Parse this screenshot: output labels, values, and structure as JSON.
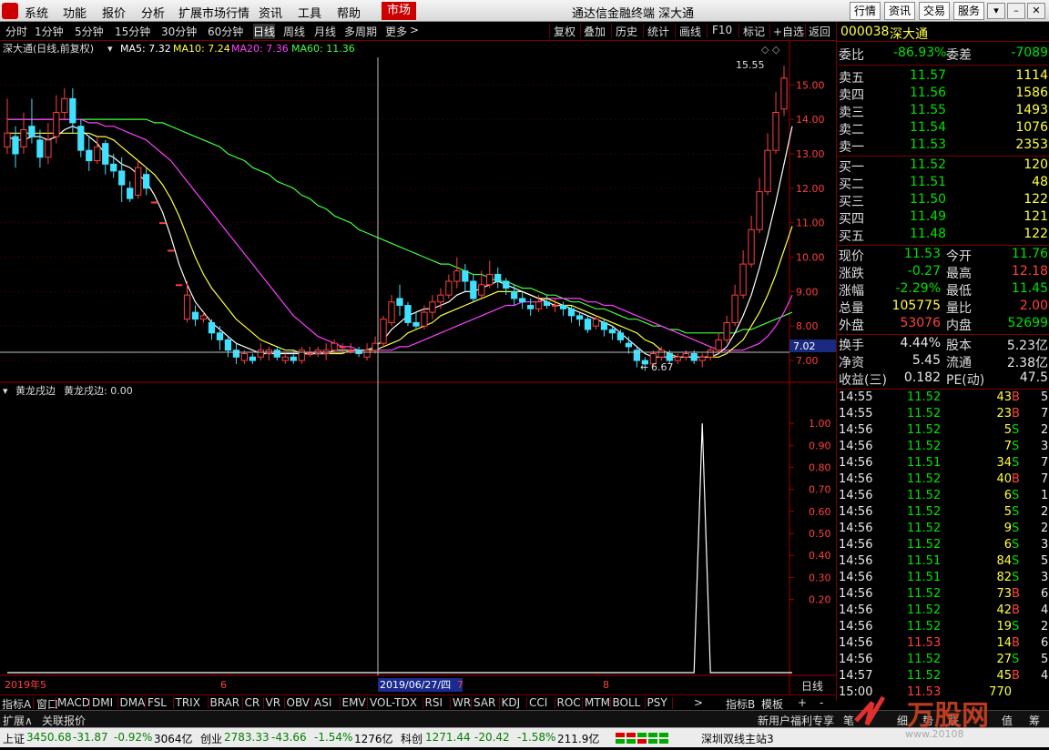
{
  "menu": {
    "items": [
      "系统",
      "功能",
      "报价",
      "分析",
      "扩展市场行情",
      "资讯",
      "工具",
      "帮助"
    ],
    "active": "市场",
    "title": "通达信金融终端 深大通",
    "right_buttons": [
      "行情",
      "资讯",
      "交易",
      "服务"
    ]
  },
  "toolbar": {
    "periods": [
      "分时",
      "1分钟",
      "5分钟",
      "15分钟",
      "30分钟",
      "60分钟",
      "日线",
      "周线",
      "月线",
      "多周期",
      "更多"
    ],
    "active_period": "日线",
    "actions": [
      "复权",
      "叠加",
      "历史",
      "统计",
      "画线",
      "F10",
      "标记",
      "+自选",
      "返回"
    ]
  },
  "chart": {
    "header": "深大通(日线,前复权)",
    "ma_labels": [
      {
        "text": "MA5: 7.32",
        "color": "#ffffff"
      },
      {
        "text": "MA10: 7.24",
        "color": "#ffff40"
      },
      {
        "text": "MA20: 7.36",
        "color": "#ff40ff"
      },
      {
        "text": "MA60: 11.36",
        "color": "#40ff40"
      }
    ],
    "price_axis": [
      "15.00",
      "14.00",
      "13.00",
      "12.00",
      "11.00",
      "10.00",
      "9.00",
      "8.00",
      "7.00"
    ],
    "current_price_tag": "7.02",
    "high_marker": "15.55",
    "low_marker": "6.67",
    "indicator_title": "黄龙戌边",
    "indicator_value": "黄龙戌边: 0.00",
    "indicator_axis": [
      "1.00",
      "0.90",
      "0.80",
      "0.70",
      "0.60",
      "0.50",
      "0.40",
      "0.30",
      "0.20"
    ],
    "date_labels": [
      "2019年5",
      "6",
      "2019/06/27/四",
      "7",
      "8"
    ],
    "date_axis_right": "日线",
    "high_price": 15.55,
    "low_price": 6.67
  },
  "chart_data": {
    "type": "candlestick",
    "candles": [
      [
        13.2,
        13.6,
        13.0,
        14.6
      ],
      [
        13.5,
        13.0,
        12.6,
        13.8
      ],
      [
        13.2,
        13.7,
        13.0,
        14.2
      ],
      [
        13.8,
        13.5,
        13.3,
        14.6
      ],
      [
        13.4,
        12.9,
        12.6,
        13.7
      ],
      [
        12.9,
        13.4,
        12.7,
        13.9
      ],
      [
        13.5,
        14.2,
        13.3,
        14.7
      ],
      [
        14.2,
        14.6,
        14.0,
        14.9
      ],
      [
        14.6,
        13.9,
        13.6,
        14.9
      ],
      [
        13.8,
        13.1,
        12.9,
        14.0
      ],
      [
        13.1,
        12.8,
        12.5,
        13.5
      ],
      [
        12.8,
        13.2,
        12.7,
        13.5
      ],
      [
        13.3,
        12.7,
        12.4,
        13.4
      ],
      [
        12.7,
        12.5,
        12.3,
        13.0
      ],
      [
        12.5,
        12.1,
        11.6,
        12.9
      ],
      [
        12.0,
        11.7,
        11.6,
        12.2
      ],
      [
        11.8,
        12.6,
        11.7,
        12.8
      ],
      [
        12.4,
        12.0,
        11.8,
        12.6
      ],
      [
        11.6,
        11.6,
        11.6,
        11.6
      ],
      [
        11.0,
        11.0,
        11.0,
        11.0
      ],
      [
        10.2,
        10.2,
        10.2,
        10.2
      ],
      [
        9.2,
        9.2,
        9.2,
        9.2
      ],
      [
        8.2,
        8.9,
        8.1,
        9.3
      ],
      [
        8.4,
        8.2,
        8.0,
        8.6
      ],
      [
        8.2,
        8.3,
        8.1,
        8.4
      ],
      [
        8.1,
        7.8,
        7.6,
        8.2
      ],
      [
        7.8,
        7.6,
        7.3,
        8.0
      ],
      [
        7.6,
        7.3,
        7.1,
        7.7
      ],
      [
        7.3,
        7.1,
        6.9,
        7.5
      ],
      [
        7.0,
        7.2,
        6.9,
        7.3
      ],
      [
        7.1,
        7.0,
        6.9,
        7.2
      ],
      [
        7.1,
        7.3,
        7.0,
        7.5
      ],
      [
        7.2,
        7.3,
        7.0,
        7.4
      ],
      [
        7.3,
        7.1,
        7.0,
        7.4
      ],
      [
        7.0,
        7.1,
        6.9,
        7.2
      ],
      [
        7.1,
        7.0,
        6.9,
        7.3
      ],
      [
        7.0,
        7.3,
        6.9,
        7.4
      ],
      [
        7.2,
        7.2,
        7.1,
        7.4
      ],
      [
        7.2,
        7.3,
        7.1,
        7.4
      ],
      [
        7.2,
        7.3,
        7.0,
        7.5
      ],
      [
        7.3,
        7.5,
        7.2,
        7.6
      ],
      [
        7.4,
        7.4,
        7.2,
        7.5
      ],
      [
        7.3,
        7.3,
        7.2,
        7.5
      ],
      [
        7.3,
        7.2,
        7.1,
        7.4
      ],
      [
        7.1,
        7.3,
        7.0,
        7.5
      ],
      [
        7.3,
        7.5,
        7.2,
        7.7
      ],
      [
        7.5,
        8.2,
        7.4,
        8.3
      ],
      [
        8.1,
        8.7,
        8.0,
        8.9
      ],
      [
        8.8,
        8.6,
        8.3,
        9.2
      ],
      [
        8.6,
        8.1,
        8.0,
        8.7
      ],
      [
        8.1,
        8.0,
        7.9,
        8.4
      ],
      [
        8.0,
        8.4,
        7.9,
        8.6
      ],
      [
        8.4,
        8.7,
        8.2,
        8.9
      ],
      [
        8.7,
        8.9,
        8.5,
        9.1
      ],
      [
        8.9,
        9.3,
        8.8,
        9.5
      ],
      [
        9.3,
        9.6,
        9.1,
        10.0
      ],
      [
        9.6,
        9.3,
        9.0,
        9.8
      ],
      [
        9.3,
        8.8,
        8.7,
        9.5
      ],
      [
        8.9,
        9.2,
        8.8,
        9.6
      ],
      [
        9.2,
        9.5,
        9.1,
        9.9
      ],
      [
        9.5,
        9.3,
        9.1,
        9.7
      ],
      [
        9.3,
        9.1,
        8.9,
        9.4
      ],
      [
        9.0,
        8.8,
        8.6,
        9.2
      ],
      [
        8.8,
        8.7,
        8.5,
        9.0
      ],
      [
        8.6,
        8.5,
        8.3,
        8.8
      ],
      [
        8.5,
        8.7,
        8.4,
        8.9
      ],
      [
        8.7,
        8.6,
        8.5,
        8.9
      ],
      [
        8.6,
        8.6,
        8.4,
        8.8
      ],
      [
        8.6,
        8.5,
        8.3,
        8.7
      ],
      [
        8.5,
        8.3,
        8.1,
        8.6
      ],
      [
        8.3,
        8.2,
        8.0,
        8.4
      ],
      [
        8.2,
        7.9,
        7.8,
        8.3
      ],
      [
        8.0,
        8.2,
        7.9,
        8.3
      ],
      [
        8.1,
        7.9,
        7.7,
        8.2
      ],
      [
        7.9,
        7.8,
        7.6,
        8.0
      ],
      [
        7.8,
        7.6,
        7.5,
        7.9
      ],
      [
        7.5,
        7.4,
        7.2,
        7.7
      ],
      [
        7.3,
        7.0,
        6.8,
        7.4
      ],
      [
        7.0,
        6.9,
        6.7,
        7.1
      ],
      [
        6.9,
        7.2,
        6.8,
        7.3
      ],
      [
        7.1,
        7.3,
        7.0,
        7.4
      ],
      [
        7.2,
        7.0,
        6.9,
        7.3
      ],
      [
        7.0,
        7.1,
        6.9,
        7.2
      ],
      [
        7.1,
        7.2,
        7.0,
        7.3
      ],
      [
        7.2,
        7.0,
        6.9,
        7.3
      ],
      [
        7.0,
        7.1,
        6.8,
        7.2
      ],
      [
        7.1,
        7.3,
        7.0,
        7.4
      ],
      [
        7.3,
        7.6,
        7.2,
        7.8
      ],
      [
        7.6,
        8.1,
        7.5,
        8.3
      ],
      [
        8.1,
        8.9,
        8.0,
        9.2
      ],
      [
        8.9,
        9.8,
        8.8,
        10.2
      ],
      [
        9.8,
        10.8,
        9.7,
        11.2
      ],
      [
        10.8,
        11.9,
        10.7,
        12.3
      ],
      [
        11.9,
        13.1,
        11.8,
        13.6
      ],
      [
        13.1,
        14.2,
        13.0,
        14.8
      ],
      [
        14.3,
        15.2,
        14.1,
        15.55
      ]
    ],
    "ma5": [
      13.5,
      13.4,
      13.4,
      13.5,
      13.5,
      13.4,
      13.5,
      13.7,
      13.8,
      13.7,
      13.5,
      13.3,
      13.0,
      12.9,
      12.7,
      12.6,
      12.4,
      12.2,
      11.8,
      11.3,
      10.6,
      9.8,
      9.2,
      8.7,
      8.4,
      8.1,
      7.9,
      7.7,
      7.5,
      7.4,
      7.3,
      7.2,
      7.2,
      7.2,
      7.2,
      7.2,
      7.2,
      7.2,
      7.2,
      7.2,
      7.3,
      7.3,
      7.3,
      7.3,
      7.3,
      7.4,
      7.6,
      7.9,
      8.1,
      8.3,
      8.4,
      8.5,
      8.5,
      8.6,
      8.7,
      8.9,
      9.0,
      9.0,
      9.1,
      9.2,
      9.3,
      9.2,
      9.1,
      9.0,
      8.9,
      8.8,
      8.7,
      8.6,
      8.6,
      8.5,
      8.4,
      8.3,
      8.2,
      8.1,
      8.0,
      7.8,
      7.6,
      7.4,
      7.2,
      7.1,
      7.1,
      7.1,
      7.1,
      7.1,
      7.1,
      7.1,
      7.1,
      7.2,
      7.4,
      7.8,
      8.3,
      8.9,
      9.7,
      10.6,
      11.6,
      12.7,
      13.8
    ],
    "ma10": [
      13.6,
      13.6,
      13.6,
      13.6,
      13.6,
      13.6,
      13.6,
      13.6,
      13.6,
      13.6,
      13.6,
      13.5,
      13.5,
      13.4,
      13.2,
      13.0,
      12.8,
      12.6,
      12.4,
      12.1,
      11.7,
      11.2,
      10.6,
      10.0,
      9.5,
      9.1,
      8.8,
      8.5,
      8.2,
      8.0,
      7.8,
      7.6,
      7.5,
      7.4,
      7.3,
      7.3,
      7.2,
      7.2,
      7.2,
      7.2,
      7.2,
      7.2,
      7.3,
      7.3,
      7.3,
      7.3,
      7.4,
      7.5,
      7.6,
      7.8,
      7.9,
      8.0,
      8.1,
      8.3,
      8.4,
      8.5,
      8.6,
      8.7,
      8.8,
      8.9,
      9.0,
      9.0,
      9.0,
      9.0,
      8.9,
      8.8,
      8.8,
      8.7,
      8.6,
      8.6,
      8.5,
      8.4,
      8.3,
      8.2,
      8.1,
      8.0,
      7.9,
      7.8,
      7.6,
      7.5,
      7.3,
      7.2,
      7.1,
      7.1,
      7.1,
      7.1,
      7.1,
      7.1,
      7.2,
      7.4,
      7.6,
      8.0,
      8.4,
      8.9,
      9.5,
      10.2,
      10.9
    ],
    "ma20": [
      14.0,
      14.0,
      14.0,
      14.0,
      14.0,
      14.0,
      14.0,
      14.0,
      14.0,
      14.0,
      13.9,
      13.9,
      13.8,
      13.8,
      13.7,
      13.6,
      13.5,
      13.4,
      13.2,
      13.0,
      12.8,
      12.5,
      12.2,
      11.9,
      11.6,
      11.3,
      11.0,
      10.7,
      10.4,
      10.1,
      9.8,
      9.5,
      9.2,
      8.9,
      8.6,
      8.3,
      8.1,
      7.9,
      7.7,
      7.6,
      7.5,
      7.4,
      7.4,
      7.3,
      7.3,
      7.3,
      7.3,
      7.3,
      7.4,
      7.4,
      7.5,
      7.6,
      7.7,
      7.8,
      7.9,
      8.0,
      8.1,
      8.2,
      8.3,
      8.4,
      8.5,
      8.6,
      8.6,
      8.7,
      8.7,
      8.7,
      8.8,
      8.8,
      8.8,
      8.8,
      8.8,
      8.7,
      8.7,
      8.6,
      8.6,
      8.5,
      8.4,
      8.3,
      8.2,
      8.1,
      8.0,
      7.9,
      7.8,
      7.7,
      7.6,
      7.5,
      7.4,
      7.3,
      7.3,
      7.3,
      7.3,
      7.4,
      7.5,
      7.7,
      8.0,
      8.4,
      8.9
    ],
    "ma60": [
      14.0,
      14.0,
      14.0,
      14.0,
      14.0,
      14.0,
      14.0,
      14.0,
      14.0,
      14.0,
      14.0,
      14.0,
      14.0,
      14.0,
      14.0,
      14.0,
      14.0,
      14.0,
      13.9,
      13.9,
      13.8,
      13.7,
      13.6,
      13.5,
      13.4,
      13.3,
      13.2,
      13.0,
      12.9,
      12.8,
      12.6,
      12.5,
      12.4,
      12.2,
      12.1,
      12.0,
      11.8,
      11.7,
      11.5,
      11.4,
      11.2,
      11.1,
      11.0,
      10.8,
      10.7,
      10.6,
      10.5,
      10.4,
      10.3,
      10.2,
      10.1,
      10.0,
      9.9,
      9.8,
      9.8,
      9.7,
      9.6,
      9.5,
      9.5,
      9.4,
      9.3,
      9.3,
      9.2,
      9.1,
      9.1,
      9.0,
      8.9,
      8.9,
      8.8,
      8.7,
      8.7,
      8.6,
      8.5,
      8.5,
      8.4,
      8.3,
      8.2,
      8.2,
      8.1,
      8.0,
      8.0,
      7.9,
      7.9,
      7.8,
      7.8,
      7.8,
      7.8,
      7.8,
      7.8,
      7.8,
      7.9,
      7.9,
      8.0,
      8.1,
      8.2,
      8.3,
      8.4
    ],
    "indicator": [
      0,
      0,
      0,
      0,
      0,
      0,
      0,
      0,
      0,
      0,
      0,
      0,
      0,
      0,
      0,
      0,
      0,
      0,
      0,
      0,
      0,
      0,
      0,
      0,
      0,
      0,
      0,
      0,
      0,
      0,
      0,
      0,
      0,
      0,
      0,
      0,
      0,
      0,
      0,
      0,
      0,
      0,
      0,
      0,
      0,
      0,
      0,
      0,
      0,
      0,
      0,
      0,
      0,
      0,
      0,
      0,
      0,
      0,
      0,
      0,
      0,
      0,
      0,
      0,
      0,
      0,
      0,
      0,
      0,
      0,
      0,
      0,
      0,
      0,
      0,
      0,
      0,
      0,
      0,
      0,
      0,
      0,
      0,
      0,
      0,
      1,
      0,
      0,
      0,
      0,
      0,
      0,
      0,
      0,
      0,
      0,
      0
    ]
  },
  "quote": {
    "code": "000038",
    "name": "深大通",
    "weibi_label": "委比",
    "weibi": "-86.93%",
    "weicha_label": "委差",
    "weicha": "-7089",
    "asks": [
      {
        "label": "卖五",
        "price": "11.57",
        "vol": "1114"
      },
      {
        "label": "卖四",
        "price": "11.56",
        "vol": "1586"
      },
      {
        "label": "卖三",
        "price": "11.55",
        "vol": "1493"
      },
      {
        "label": "卖二",
        "price": "11.54",
        "vol": "1076"
      },
      {
        "label": "卖一",
        "price": "11.53",
        "vol": "2353"
      }
    ],
    "bids": [
      {
        "label": "买一",
        "price": "11.52",
        "vol": "120"
      },
      {
        "label": "买二",
        "price": "11.51",
        "vol": "48"
      },
      {
        "label": "买三",
        "price": "11.50",
        "vol": "122"
      },
      {
        "label": "买四",
        "price": "11.49",
        "vol": "121"
      },
      {
        "label": "买五",
        "price": "11.48",
        "vol": "122"
      }
    ],
    "stats": [
      {
        "l1": "现价",
        "v1": "11.53",
        "c1": "g",
        "l2": "今开",
        "v2": "11.76",
        "c2": "g"
      },
      {
        "l1": "涨跌",
        "v1": "-0.27",
        "c1": "g",
        "l2": "最高",
        "v2": "12.18",
        "c2": "r"
      },
      {
        "l1": "涨幅",
        "v1": "-2.29%",
        "c1": "g",
        "l2": "最低",
        "v2": "11.45",
        "c2": "g"
      },
      {
        "l1": "总量",
        "v1": "105775",
        "c1": "y",
        "l2": "量比",
        "v2": "2.00",
        "c2": "r"
      },
      {
        "l1": "外盘",
        "v1": "53076",
        "c1": "r",
        "l2": "内盘",
        "v2": "52699",
        "c2": "g"
      }
    ],
    "stats2": [
      {
        "l1": "换手",
        "v1": "4.44%",
        "l2": "股本",
        "v2": "5.23亿"
      },
      {
        "l1": "净资",
        "v1": "5.45",
        "l2": "流通",
        "v2": "2.38亿"
      },
      {
        "l1": "收益(三)",
        "v1": "0.182",
        "l2": "PE(动)",
        "v2": "47.5"
      }
    ],
    "ticks": [
      [
        "14:55",
        "11.52",
        "43",
        "B",
        "5"
      ],
      [
        "14:55",
        "11.52",
        "23",
        "B",
        "7"
      ],
      [
        "14:56",
        "11.52",
        "5",
        "S",
        "2"
      ],
      [
        "14:56",
        "11.52",
        "7",
        "S",
        "3"
      ],
      [
        "14:56",
        "11.51",
        "34",
        "S",
        "7"
      ],
      [
        "14:56",
        "11.52",
        "40",
        "B",
        "7"
      ],
      [
        "14:56",
        "11.52",
        "6",
        "S",
        "1"
      ],
      [
        "14:56",
        "11.52",
        "5",
        "S",
        "2"
      ],
      [
        "14:56",
        "11.52",
        "9",
        "S",
        "2"
      ],
      [
        "14:56",
        "11.52",
        "6",
        "S",
        "3"
      ],
      [
        "14:56",
        "11.51",
        "84",
        "S",
        "5"
      ],
      [
        "14:56",
        "11.51",
        "82",
        "S",
        "3"
      ],
      [
        "14:56",
        "11.52",
        "73",
        "B",
        "6"
      ],
      [
        "14:56",
        "11.52",
        "42",
        "B",
        "4"
      ],
      [
        "14:56",
        "11.52",
        "19",
        "S",
        "2"
      ],
      [
        "14:56",
        "11.53",
        "14",
        "B",
        "6"
      ],
      [
        "14:56",
        "11.52",
        "27",
        "S",
        "5"
      ],
      [
        "14:57",
        "11.52",
        "45",
        "B",
        "4"
      ],
      [
        "15:00",
        "11.53",
        "770",
        "",
        ""
      ]
    ]
  },
  "indicator_bar": {
    "left": "指标A",
    "items": [
      "窗口",
      "MACD",
      "DMI",
      "DMA",
      "FSL",
      "TRIX",
      "BRAR",
      "CR",
      "VR",
      "OBV",
      "ASI",
      "EMV",
      "VOL-TDX",
      "RSI",
      "WR",
      "SAR",
      "KDJ",
      "CCI",
      "ROC",
      "MTM",
      "BOLL",
      "PSY"
    ],
    "right": [
      "指标B",
      "模板",
      "+",
      "-"
    ]
  },
  "ext_bar": {
    "items": [
      "扩展∧",
      "关联报价"
    ],
    "right": "新用户福利专享",
    "right2": "笔",
    "right3": "细",
    "right4": "势",
    "right5": "联",
    "right6": "值",
    "right7": "筹"
  },
  "status": {
    "sh": {
      "name": "上证",
      "price": "3450.68",
      "chg": "-31.87",
      "pct": "-0.92%",
      "amt": "3064亿"
    },
    "cy": {
      "name": "创业",
      "price": "2783.33",
      "chg": "-43.66",
      "pct": "-1.54%",
      "amt": "1276亿"
    },
    "kc": {
      "name": "科创",
      "price": "1271.44",
      "chg": "-20.42",
      "pct": "-1.58%",
      "amt": "211.9亿"
    },
    "station": "深圳双线主站3"
  },
  "watermark": {
    "text": "万股网",
    "url": "www.20108"
  },
  "colors": {
    "up": "#ff4040",
    "down": "#40e0ff",
    "ma5": "#ffffff",
    "ma10": "#ffff40",
    "ma20": "#ff40ff",
    "ma60": "#40ff40",
    "frame": "#a00000"
  }
}
